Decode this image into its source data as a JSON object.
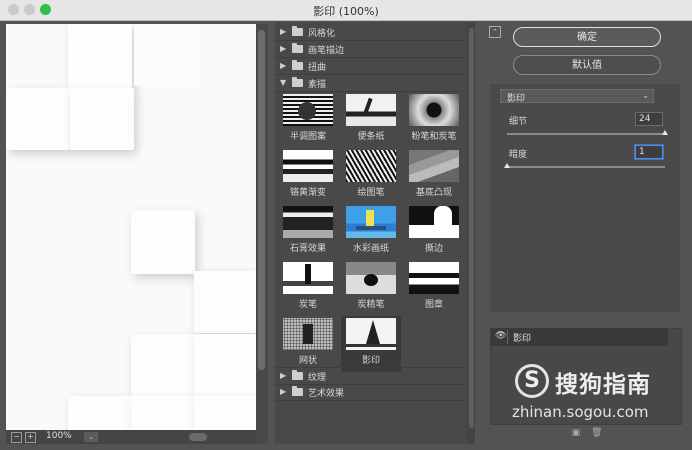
{
  "window": {
    "title": "影印 (100%)"
  },
  "preview": {
    "zoom": "100%",
    "zoom_out": "−",
    "zoom_in": "+",
    "zoom_dropdown": "⌄"
  },
  "gallery": {
    "folders_top": [
      {
        "label": "风格化",
        "arrow": "▶"
      },
      {
        "label": "画笔描边",
        "arrow": "▶"
      },
      {
        "label": "扭曲",
        "arrow": "▶"
      },
      {
        "label": "素描",
        "arrow": "▼"
      }
    ],
    "filters": [
      "半调图案",
      "便条纸",
      "粉笔和炭笔",
      "铬黄渐变",
      "绘图笔",
      "基底凸现",
      "石膏效果",
      "水彩画纸",
      "撕边",
      "炭笔",
      "炭精笔",
      "图章",
      "网状",
      "影印"
    ],
    "selected_filter": "影印",
    "folders_bottom": [
      {
        "label": "纹理",
        "arrow": "▶"
      },
      {
        "label": "艺术效果",
        "arrow": "▶"
      }
    ]
  },
  "buttons": {
    "ok": "确定",
    "reset": "默认值",
    "collapse": "⌃"
  },
  "settings": {
    "filter_select": "影印",
    "select_arrow": "⌄",
    "detail": {
      "label": "细节",
      "value": "24",
      "level": 1.0
    },
    "darkness": {
      "label": "暗度",
      "value": "1",
      "level": 0.0
    }
  },
  "layers": {
    "eye": "👁",
    "name": "影印",
    "new_icon": "▣",
    "delete_icon": "🗑"
  },
  "watermark": {
    "logo": "S",
    "title": "搜狗指南",
    "url": "zhinan.sogou.com"
  }
}
